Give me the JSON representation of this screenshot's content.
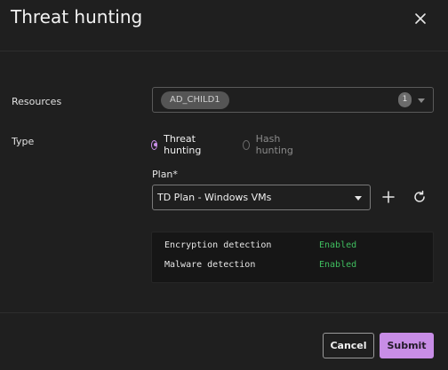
{
  "dialog": {
    "title": "Threat hunting"
  },
  "resources": {
    "label": "Resources",
    "selected_chip": "AD_CHILD1",
    "count": "1"
  },
  "type": {
    "label": "Type",
    "options": [
      {
        "label": "Threat hunting",
        "checked": true
      },
      {
        "label": "Hash hunting",
        "checked": false
      }
    ]
  },
  "plan": {
    "label": "Plan",
    "required_marker": "*",
    "selected": "TD Plan - Windows VMs"
  },
  "info": {
    "rows": [
      {
        "key": "Encryption detection",
        "value": "Enabled"
      },
      {
        "key": "Malware detection",
        "value": "Enabled"
      }
    ],
    "status_color": "#3fbf5f"
  },
  "footer": {
    "cancel_label": "Cancel",
    "submit_label": "Submit"
  },
  "colors": {
    "accent": "#c88de6",
    "background": "#1f1f1f"
  }
}
